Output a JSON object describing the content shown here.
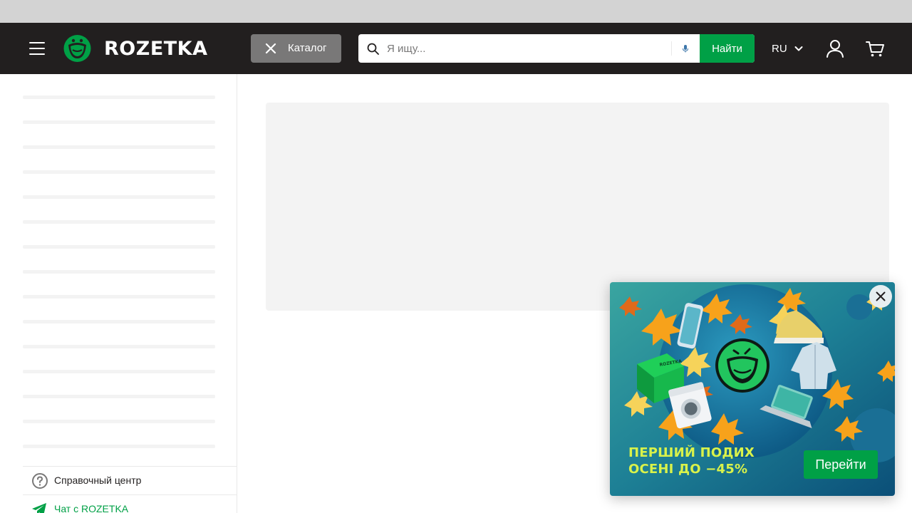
{
  "header": {
    "brand": "ROZETKA",
    "catalog_label": "Каталог",
    "search": {
      "placeholder": "Я ищу...",
      "value": "",
      "submit_label": "Найти"
    },
    "language": "RU"
  },
  "sidebar": {
    "skeleton_rows": 15,
    "help_center_label": "Справочный центр",
    "chat_label": "Чат с ROZETKA"
  },
  "promo_popup": {
    "headline_line1": "ПЕРШИЙ ПОДИХ",
    "headline_line2": "ОСЕНІ ДО −45%",
    "button_label": "Перейти",
    "box_text": "ROZETKA"
  },
  "colors": {
    "header_bg": "#221f1f",
    "accent_green": "#00a046",
    "catalog_active_bg": "#797878",
    "skeleton": "#f3f3f3",
    "promo_text": "#d9f24a"
  },
  "icons": [
    "menu-icon",
    "logo-mark-icon",
    "close-icon",
    "search-icon",
    "mic-icon",
    "chevron-down-icon",
    "user-icon",
    "cart-icon",
    "question-icon",
    "telegram-icon"
  ]
}
